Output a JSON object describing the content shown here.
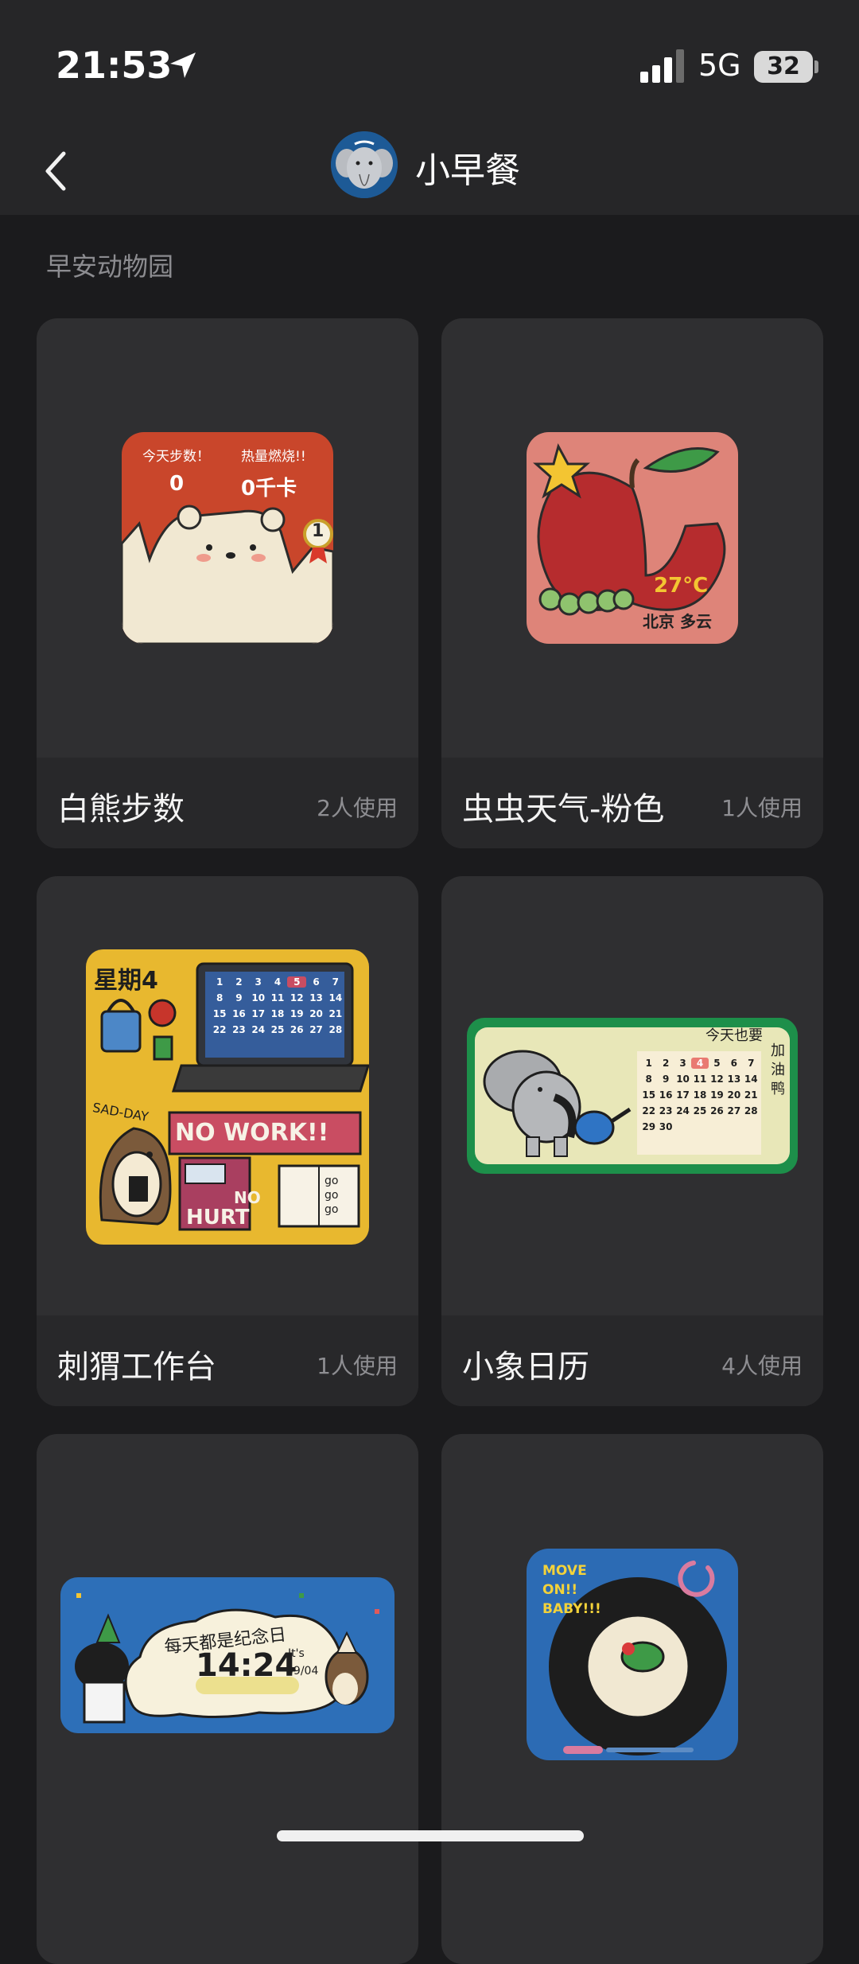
{
  "status": {
    "time": "21:53",
    "network": "5G",
    "battery": "32"
  },
  "nav": {
    "title": "小早餐"
  },
  "section": "早安动物园",
  "widgets": [
    {
      "name": "白熊步数",
      "usage": "2人使用",
      "thumb": {
        "label1": "今天步数！",
        "value1": "0",
        "label2": "热量燃烧!!",
        "value2": "0千卡",
        "badge": "1"
      }
    },
    {
      "name": "虫虫天气-粉色",
      "usage": "1人使用",
      "thumb": {
        "temp": "27°C",
        "location": "北京 多云"
      }
    },
    {
      "name": "刺猬工作台",
      "usage": "1人使用",
      "thumb": {
        "weekday": "星期4",
        "calendar": [
          "1",
          "2",
          "3",
          "4",
          "5",
          "6",
          "7",
          "8",
          "9",
          "10",
          "11",
          "12",
          "13",
          "14",
          "15",
          "16",
          "17",
          "18",
          "19",
          "20",
          "21",
          "22",
          "23",
          "24",
          "25",
          "26",
          "27",
          "28"
        ],
        "sad_day": "SAD-DAY",
        "no_work": "NO WORK!!",
        "no": "NO",
        "hurt": "HURT",
        "gogo": "go go go"
      }
    },
    {
      "name": "小象日历",
      "usage": "4人使用",
      "thumb": {
        "note": "今天也要",
        "side": "加油鸭",
        "calendar": [
          "1",
          "2",
          "3",
          "4",
          "5",
          "6",
          "7",
          "8",
          "9",
          "10",
          "11",
          "12",
          "13",
          "14",
          "15",
          "16",
          "17",
          "18",
          "19",
          "20",
          "21",
          "22",
          "23",
          "24",
          "25",
          "26",
          "27",
          "28",
          "29",
          "30"
        ]
      }
    },
    {
      "name": "",
      "usage": "",
      "thumb": {
        "banner": "每天都是纪念日",
        "time": "14:24",
        "its": "It's",
        "date": "09/04"
      }
    },
    {
      "name": "",
      "usage": "",
      "thumb": {
        "text1": "MOVE",
        "text2": "ON!!",
        "text3": "BABY!!!"
      }
    }
  ]
}
